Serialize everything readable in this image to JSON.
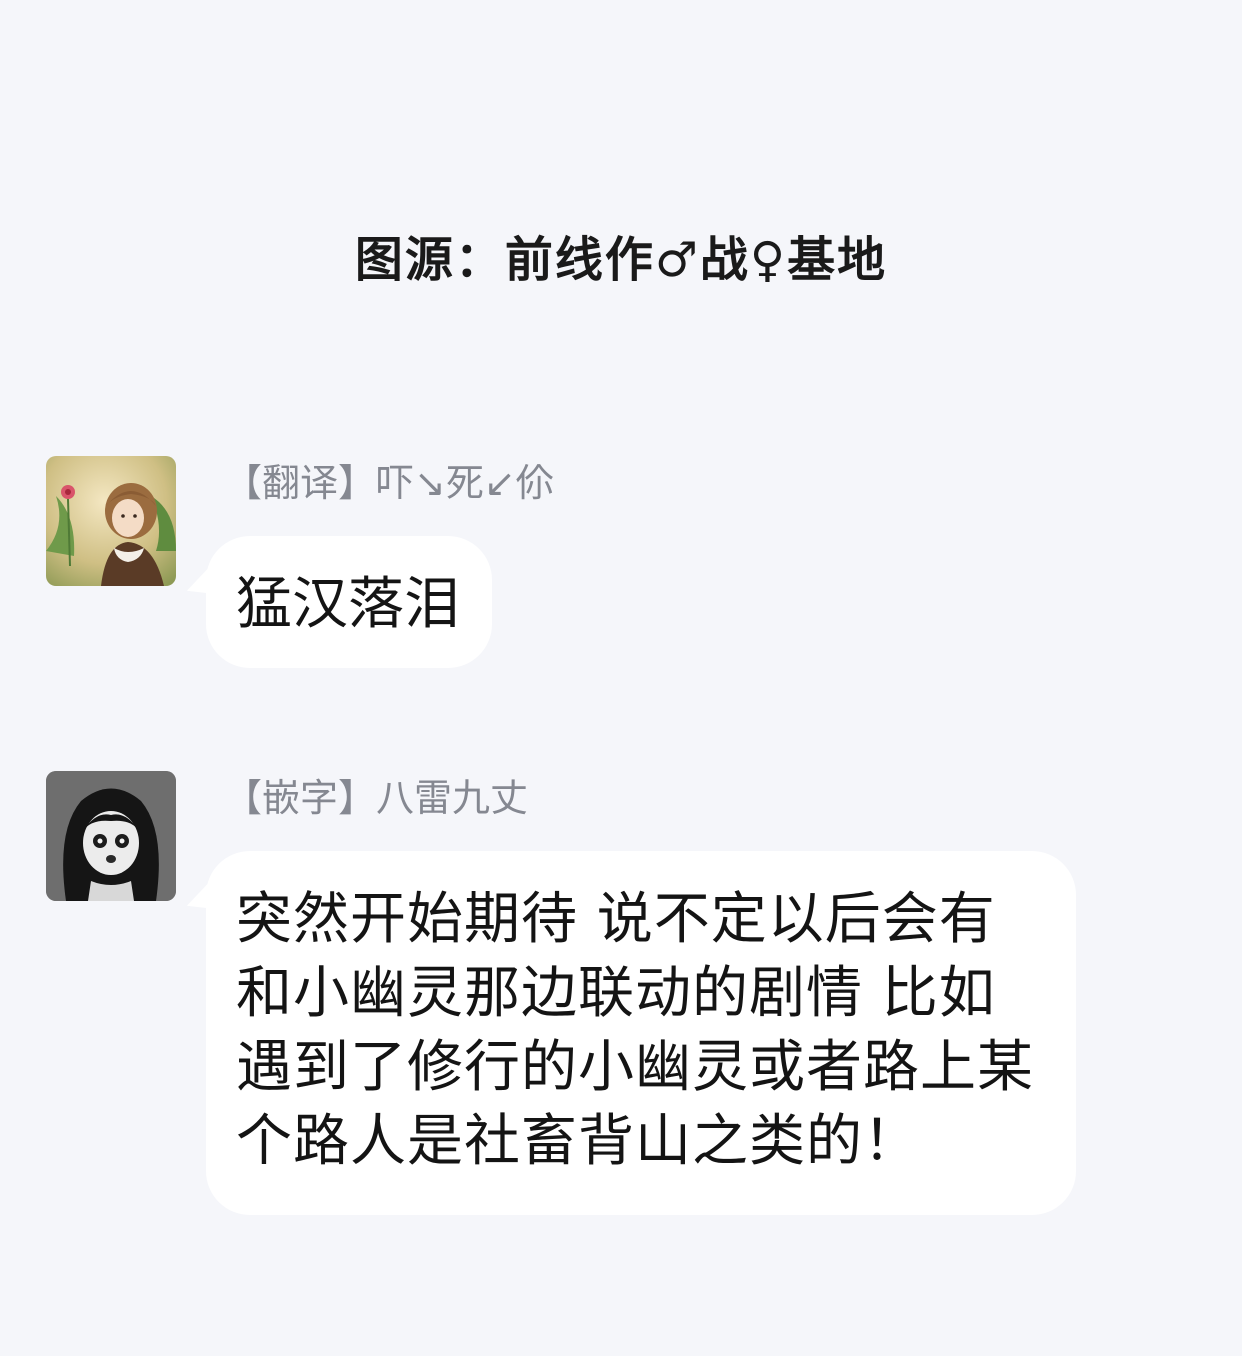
{
  "caption": "图源：前线作♂战♀基地",
  "messages": [
    {
      "sender": "【翻译】吓↘死↙伱",
      "text": "猛汉落泪",
      "avatar_icon": "girl-with-flowers-avatar"
    },
    {
      "sender": "【嵌字】八雷九丈",
      "text": "突然开始期待 说不定以后会有和小幽灵那边联动的剧情 比如遇到了修行的小幽灵或者路上某个路人是社畜背山之类的！",
      "avatar_icon": "dark-haired-ghost-girl-avatar"
    }
  ],
  "colors": {
    "background": "#f5f6fa",
    "bubble": "#ffffff",
    "sender_text": "#858891",
    "message_text": "#141414"
  }
}
